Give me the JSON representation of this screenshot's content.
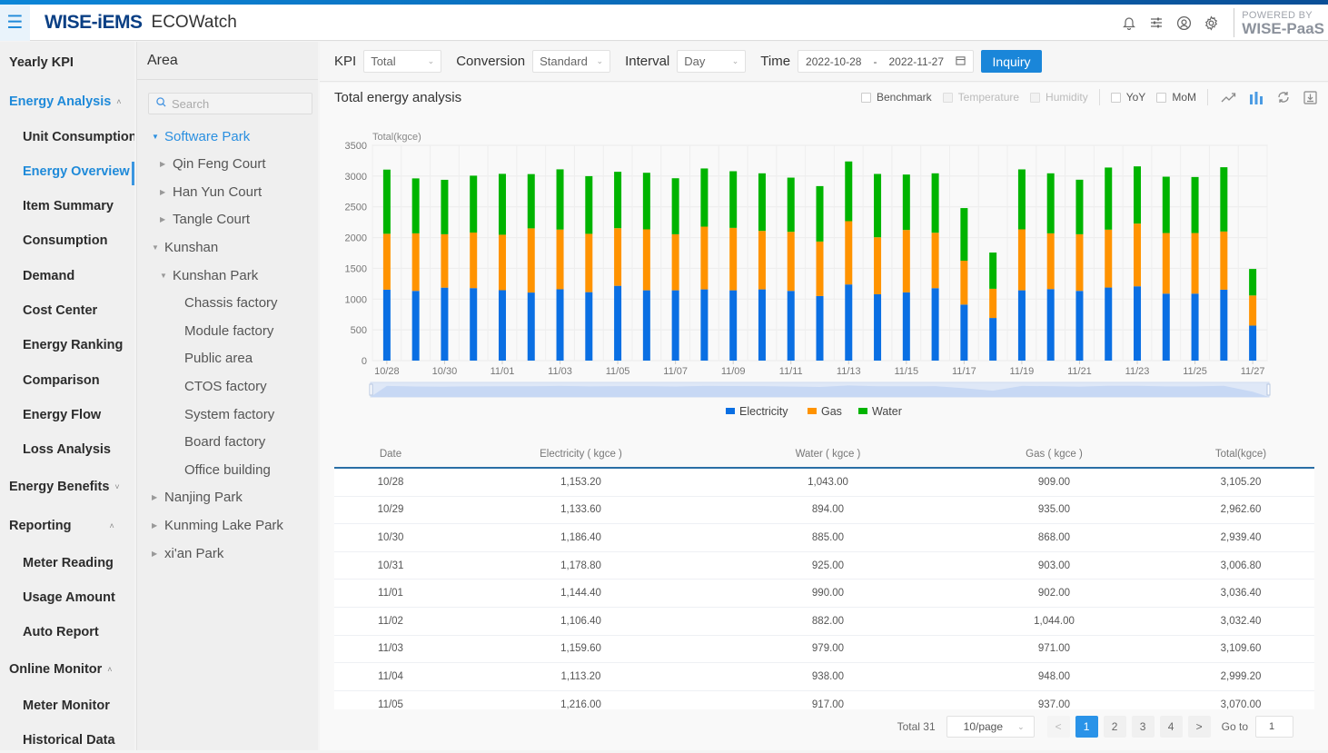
{
  "header": {
    "brand": "WISE-iEMS",
    "app_name": "ECOWatch",
    "powered_line1": "POWERED BY",
    "powered_line2": "WISE-PaaS",
    "icons": [
      "bell-icon",
      "sliders-icon",
      "user-circle-icon",
      "gear-icon"
    ]
  },
  "sidebar": {
    "items": [
      {
        "label": "Yearly KPI",
        "level": 1
      },
      {
        "label": "Energy Analysis",
        "level": 1,
        "expanded": true,
        "active_group": true
      },
      {
        "label": "Unit Consumption",
        "level": 2
      },
      {
        "label": "Energy Overview",
        "level": 2,
        "active": true
      },
      {
        "label": "Item Summary",
        "level": 2
      },
      {
        "label": "Consumption",
        "level": 2
      },
      {
        "label": "Demand",
        "level": 2
      },
      {
        "label": "Cost Center",
        "level": 2
      },
      {
        "label": "Energy Ranking",
        "level": 2
      },
      {
        "label": "Comparison",
        "level": 2
      },
      {
        "label": "Energy Flow",
        "level": 2
      },
      {
        "label": "Loss Analysis",
        "level": 2
      },
      {
        "label": "Energy Benefits",
        "level": 1,
        "expanded": false
      },
      {
        "label": "Reporting",
        "level": 1,
        "expanded": true
      },
      {
        "label": "Meter Reading",
        "level": 2
      },
      {
        "label": "Usage Amount",
        "level": 2
      },
      {
        "label": "Auto Report",
        "level": 2
      },
      {
        "label": "Online Monitor",
        "level": 1,
        "expanded": true
      },
      {
        "label": "Meter Monitor",
        "level": 2
      },
      {
        "label": "Historical Data",
        "level": 2
      }
    ]
  },
  "area": {
    "title": "Area",
    "search_placeholder": "Search",
    "tree": [
      {
        "label": "Software Park",
        "depth": 0,
        "toggle": "expanded",
        "selected": true
      },
      {
        "label": "Qin Feng Court",
        "depth": 1,
        "toggle": "collapsed"
      },
      {
        "label": "Han Yun Court",
        "depth": 1,
        "toggle": "collapsed"
      },
      {
        "label": "Tangle Court",
        "depth": 1,
        "toggle": "collapsed"
      },
      {
        "label": "Kunshan",
        "depth": 0,
        "toggle": "expanded"
      },
      {
        "label": "Kunshan Park",
        "depth": 1,
        "toggle": "expanded"
      },
      {
        "label": "Chassis factory",
        "depth": 2,
        "toggle": "none"
      },
      {
        "label": "Module factory",
        "depth": 2,
        "toggle": "none"
      },
      {
        "label": "Public area",
        "depth": 2,
        "toggle": "none"
      },
      {
        "label": "CTOS factory",
        "depth": 2,
        "toggle": "none"
      },
      {
        "label": "System factory",
        "depth": 2,
        "toggle": "none"
      },
      {
        "label": "Board factory",
        "depth": 2,
        "toggle": "none"
      },
      {
        "label": "Office building",
        "depth": 2,
        "toggle": "none"
      },
      {
        "label": "Nanjing Park",
        "depth": 0,
        "toggle": "collapsed"
      },
      {
        "label": "Kunming Lake Park",
        "depth": 0,
        "toggle": "collapsed"
      },
      {
        "label": "xi'an Park",
        "depth": 0,
        "toggle": "collapsed"
      }
    ]
  },
  "toolbar": {
    "kpi_label": "KPI",
    "kpi_value": "Total",
    "conversion_label": "Conversion",
    "conversion_value": "Standard",
    "interval_label": "Interval",
    "interval_value": "Day",
    "time_label": "Time",
    "date_start": "2022-10-28",
    "date_sep": "-",
    "date_end": "2022-11-27",
    "inquiry_label": "Inquiry"
  },
  "panel": {
    "title": "Total energy analysis",
    "options": [
      {
        "label": "Benchmark",
        "checked": false,
        "disabled": false
      },
      {
        "label": "Temperature",
        "checked": false,
        "disabled": true
      },
      {
        "label": "Humidity",
        "checked": false,
        "disabled": true
      },
      {
        "label": "YoY",
        "checked": false,
        "disabled": false
      },
      {
        "label": "MoM",
        "checked": false,
        "disabled": false
      }
    ],
    "tools": [
      "line-chart-icon",
      "bar-chart-icon",
      "refresh-icon",
      "download-icon"
    ]
  },
  "chart_data": {
    "type": "bar",
    "stacked": true,
    "title": "Total energy analysis",
    "ylabel": "Total(kgce)",
    "xlabel": "",
    "ylim": [
      0,
      3500
    ],
    "yticks": [
      0,
      500,
      1000,
      1500,
      2000,
      2500,
      3000,
      3500
    ],
    "grid": true,
    "legend_position": "bottom-center",
    "categories": [
      "10/28",
      "10/29",
      "10/30",
      "10/31",
      "11/01",
      "11/02",
      "11/03",
      "11/04",
      "11/05",
      "11/06",
      "11/07",
      "11/08",
      "11/09",
      "11/10",
      "11/11",
      "11/12",
      "11/13",
      "11/14",
      "11/15",
      "11/16",
      "11/17",
      "11/18",
      "11/19",
      "11/20",
      "11/21",
      "11/22",
      "11/23",
      "11/24",
      "11/25",
      "11/26",
      "11/27"
    ],
    "xtick_labels": [
      "10/28",
      "10/30",
      "11/01",
      "11/03",
      "11/05",
      "11/07",
      "11/09",
      "11/11",
      "11/13",
      "11/15",
      "11/17",
      "11/19",
      "11/21",
      "11/23",
      "11/25",
      "11/27"
    ],
    "series": [
      {
        "name": "Electricity",
        "color": "#0a6fe3",
        "values": [
          1153.2,
          1133.6,
          1186.4,
          1178.8,
          1144.4,
          1106.4,
          1159.6,
          1113.2,
          1216.0,
          1143,
          1143,
          1158,
          1143,
          1158,
          1134,
          1050,
          1238,
          1079,
          1109,
          1178,
          911,
          693,
          1143,
          1163,
          1134,
          1188,
          1208,
          1089,
          1089,
          1153,
          569
        ]
      },
      {
        "name": "Gas",
        "color": "#ff9300",
        "values": [
          909,
          935,
          868,
          903,
          902,
          1044,
          971,
          948,
          937,
          991,
          911,
          1020,
          1015,
          951,
          960,
          886,
          1029,
          926,
          1015,
          901,
          713,
          475,
          991,
          906,
          920,
          941,
          1020,
          985,
          985,
          946,
          490
        ]
      },
      {
        "name": "Water",
        "color": "#00b400",
        "values": [
          1043,
          894,
          885,
          925,
          990,
          882,
          979,
          938,
          917,
          920,
          911,
          946,
          921,
          936,
          881,
          901,
          971,
          1030,
          901,
          966,
          856,
          589,
          975,
          976,
          887,
          1010,
          930,
          916,
          911,
          1045,
          431
        ]
      }
    ],
    "slider_range": [
      0,
      100
    ]
  },
  "table": {
    "columns": [
      "Date",
      "Electricity ( kgce )",
      "Water ( kgce )",
      "Gas ( kgce )",
      "Total(kgce)"
    ],
    "rows": [
      [
        "10/28",
        "1,153.20",
        "1,043.00",
        "909.00",
        "3,105.20"
      ],
      [
        "10/29",
        "1,133.60",
        "894.00",
        "935.00",
        "2,962.60"
      ],
      [
        "10/30",
        "1,186.40",
        "885.00",
        "868.00",
        "2,939.40"
      ],
      [
        "10/31",
        "1,178.80",
        "925.00",
        "903.00",
        "3,006.80"
      ],
      [
        "11/01",
        "1,144.40",
        "990.00",
        "902.00",
        "3,036.40"
      ],
      [
        "11/02",
        "1,106.40",
        "882.00",
        "1,044.00",
        "3,032.40"
      ],
      [
        "11/03",
        "1,159.60",
        "979.00",
        "971.00",
        "3,109.60"
      ],
      [
        "11/04",
        "1,113.20",
        "938.00",
        "948.00",
        "2,999.20"
      ],
      [
        "11/05",
        "1,216.00",
        "917.00",
        "937.00",
        "3,070.00"
      ]
    ]
  },
  "pagination": {
    "total_label": "Total 31",
    "page_size": "10/page",
    "prev": "<",
    "pages": [
      "1",
      "2",
      "3",
      "4"
    ],
    "current_page": 1,
    "next": ">",
    "goto_label": "Go to",
    "goto_value": "1"
  }
}
